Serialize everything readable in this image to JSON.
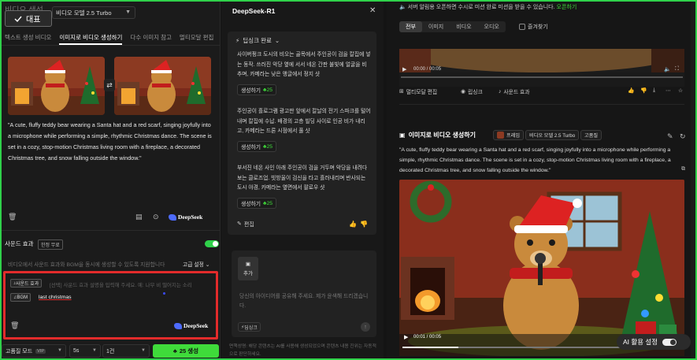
{
  "left": {
    "ghost_title": "비디오 생성",
    "represent_label": "대표",
    "model": "비디오 모델 2.5 Turbo",
    "tabs": [
      {
        "label": "텍스트 생성 비디오",
        "active": false
      },
      {
        "label": "이미지로 비디오 생성하기",
        "active": true
      },
      {
        "label": "다수 이미지 참고",
        "active": false
      },
      {
        "label": "멀티모달 편집",
        "active": false
      }
    ],
    "prompt": "\"A cute, fluffy teddy bear wearing a Santa hat and a red scarf, singing joyfully into a microphone while performing a simple, rhythmic Christmas dance. The scene is set in a cozy, stop-motion Christmas living room with a fireplace, a decorated Christmas tree, and snow falling outside the window.\"",
    "deepseek": "DeepSeek",
    "sound": {
      "label": "사운드 효과",
      "badge": "한정 무료",
      "enabled": true,
      "desc": "비디오에서 사운드 효과와 BGM을 동시에 생성할 수 있도록 지원합니다",
      "advanced": "고급 설정"
    },
    "sfx_chip": "사운드 효과",
    "sfx_placeholder": "[선택] 사운드 효과 설명을 입력해 주세요. 예: 나무 비 떨어지는 소리",
    "bgm_chip": "BGM",
    "bgm_value": "last christmas",
    "bottom": {
      "mode": "고품질 모드",
      "vip": "VIP",
      "duration": "5s",
      "count": "1건",
      "generate": "25 생성"
    }
  },
  "mid": {
    "title": "DeepSeek-R1",
    "think_done": "딥싱크 완료",
    "suggestions": [
      "사이버펑크 도시의 비오는 골목에서 주인공이 검을 칼집에 넣는 동작. 쓰러진 악당 옆에 서서 네온 간판 불빛에 얼굴을 비추며, 카메라는 낮은 앵글에서 정지 샷",
      "주인공이 흘로그램 광고판 앞에서 칼날의 전기 스파크를 털어내며 칼집에 수납. 배경의 고층 빌딩 사이로 인공 비가 내리고, 카메라는 드론 시점에서 풀 샷",
      "부서진 네온 사인 아래 주인공이 검을 거두며 악당을 내려다보는 클로즈업. 빗방울이 검신을 타고 흘러내리며 반사되는 도시 야경, 카메라는 옆면에서 팔로우 샷"
    ],
    "gen_label": "생성하기",
    "gen_cost": "25",
    "edit": "편집",
    "add": "추가",
    "input_placeholder": "당신의 아이디어를 공유해 주세요. 제가 윤색해 드리겠습니다.",
    "deepthink": "딥싱크",
    "disclaimer": "면책성명: 해당 콘텐츠는 AI를 사용해 생성되었으며 콘텐츠 내용 진위는 자동적으로 판단하세요."
  },
  "right": {
    "notice": "서버 알림용 오픈하면 수시로 미션 완료 미션을 받을 수 있습니다.",
    "notice_link": "오픈하기",
    "filters": [
      "전부",
      "이미지",
      "비디오",
      "오디오"
    ],
    "favorites": "즐겨찾기",
    "time1": "00:00 / 00:05",
    "time2": "00:01 / 00:05",
    "actions": [
      "멀티모달 편집",
      "립싱크",
      "사운드 효과"
    ],
    "card_title": "이미지로 비디오 생성하기",
    "chip_frame": "프레임",
    "chip_model": "비디오 모델 2.5 Turbo",
    "chip_quality": "고품질",
    "prompt": "\"A cute, fluffy teddy bear wearing a Santa hat and a red scarf, singing joyfully into a microphone while performing a simple, rhythmic Christmas dance. The scene is set in a cozy, stop-motion Christmas living room with a fireplace, a decorated Christmas tree, and snow falling outside the window.\"",
    "ai_setting": "AI 활용 설정"
  },
  "colors": {
    "accent": "#3fdb3a",
    "highlight": "#e22b2b",
    "frame": "#2fd14a"
  },
  "icons": [
    "check-icon",
    "chevron-down-icon",
    "swap-icon",
    "trash-icon",
    "note-icon",
    "location-icon",
    "close-icon",
    "thumb-up-icon",
    "thumb-down-icon",
    "edit-icon",
    "image-icon",
    "send-icon",
    "speaker-icon",
    "play-icon",
    "fullscreen-icon",
    "star-icon",
    "download-icon"
  ]
}
